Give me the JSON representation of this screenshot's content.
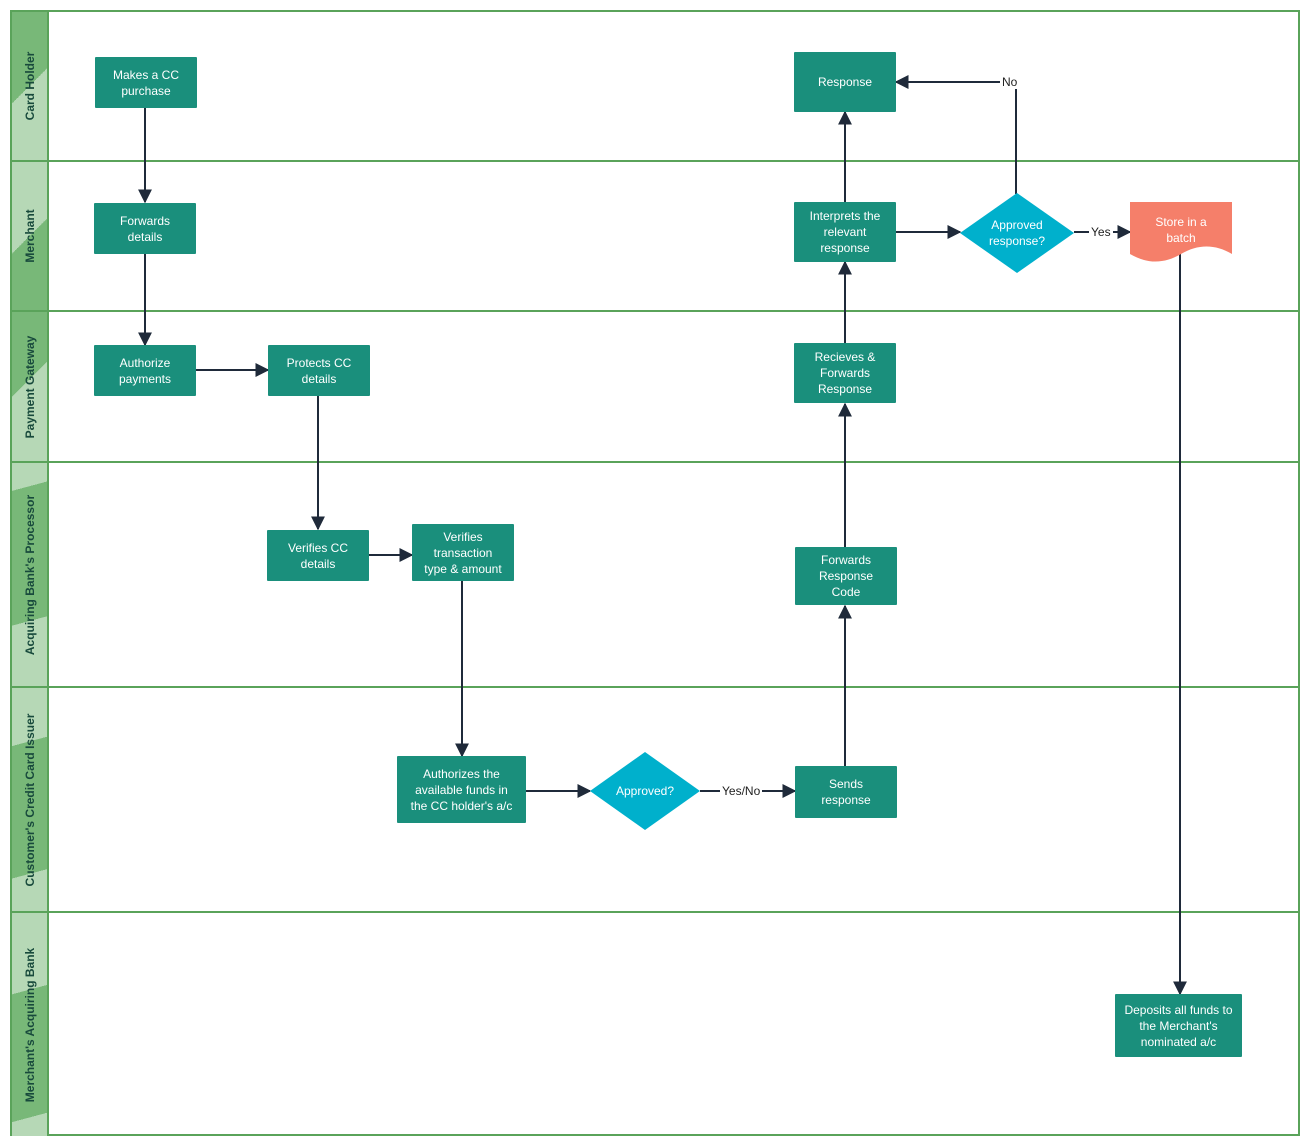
{
  "diagram": {
    "type": "swimlane-flowchart",
    "colors": {
      "lane_border": "#5aa35a",
      "lane_header_dark": "#78b878",
      "lane_header_light": "#b6d8b6",
      "lane_title_text": "#184a3c",
      "process": "#1a8f7c",
      "decision": "#00b0cc",
      "document": "#f57f6a",
      "connector": "#1f2a3a"
    },
    "lanes": [
      {
        "id": "card-holder",
        "label": "Card Holder"
      },
      {
        "id": "merchant",
        "label": "Merchant"
      },
      {
        "id": "payment-gateway",
        "label": "Payment Gateway"
      },
      {
        "id": "acquiring-processor",
        "label": "Acquiring Bank's Processor"
      },
      {
        "id": "credit-card-issuer",
        "label": "Customer's Credit Card Issuer"
      },
      {
        "id": "acquiring-bank",
        "label": "Merchant's Acquiring Bank"
      }
    ],
    "nodes": {
      "makes_purchase": {
        "lane": "card-holder",
        "shape": "process",
        "label": "Makes a CC\npurchase"
      },
      "response": {
        "lane": "card-holder",
        "shape": "process",
        "label": "Response"
      },
      "forwards_details": {
        "lane": "merchant",
        "shape": "process",
        "label": "Forwards\ndetails"
      },
      "interprets": {
        "lane": "merchant",
        "shape": "process",
        "label": "Interprets the\nrelevant\nresponse"
      },
      "approved_response": {
        "lane": "merchant",
        "shape": "decision",
        "label": "Approved\nresponse?"
      },
      "store_batch": {
        "lane": "merchant",
        "shape": "document",
        "label": "Store in a\nbatch"
      },
      "authorize_payments": {
        "lane": "payment-gateway",
        "shape": "process",
        "label": "Authorize\npayments"
      },
      "protects_cc": {
        "lane": "payment-gateway",
        "shape": "process",
        "label": "Protects CC\ndetails"
      },
      "receives_forwards": {
        "lane": "payment-gateway",
        "shape": "process",
        "label": "Recieves &\nForwards\nResponse"
      },
      "verifies_cc": {
        "lane": "acquiring-processor",
        "shape": "process",
        "label": "Verifies CC\ndetails"
      },
      "verifies_txn": {
        "lane": "acquiring-processor",
        "shape": "process",
        "label": "Verifies\ntransaction\ntype & amount"
      },
      "forwards_code": {
        "lane": "acquiring-processor",
        "shape": "process",
        "label": "Forwards\nResponse\nCode"
      },
      "authorizes_funds": {
        "lane": "credit-card-issuer",
        "shape": "process",
        "label": "Authorizes the\navailable funds in\nthe CC holder's a/c"
      },
      "approved": {
        "lane": "credit-card-issuer",
        "shape": "decision",
        "label": "Approved?"
      },
      "sends_response": {
        "lane": "credit-card-issuer",
        "shape": "process",
        "label": "Sends\nresponse"
      },
      "deposits": {
        "lane": "acquiring-bank",
        "shape": "process",
        "label": "Deposits all funds to\nthe Merchant's\nnominated a/c"
      }
    },
    "edges": [
      {
        "from": "makes_purchase",
        "to": "forwards_details",
        "label": ""
      },
      {
        "from": "forwards_details",
        "to": "authorize_payments",
        "label": ""
      },
      {
        "from": "authorize_payments",
        "to": "protects_cc",
        "label": ""
      },
      {
        "from": "protects_cc",
        "to": "verifies_cc",
        "label": ""
      },
      {
        "from": "verifies_cc",
        "to": "verifies_txn",
        "label": ""
      },
      {
        "from": "verifies_txn",
        "to": "authorizes_funds",
        "label": ""
      },
      {
        "from": "authorizes_funds",
        "to": "approved",
        "label": ""
      },
      {
        "from": "approved",
        "to": "sends_response",
        "label": "Yes/No"
      },
      {
        "from": "sends_response",
        "to": "forwards_code",
        "label": ""
      },
      {
        "from": "forwards_code",
        "to": "receives_forwards",
        "label": ""
      },
      {
        "from": "receives_forwards",
        "to": "interprets",
        "label": ""
      },
      {
        "from": "interprets",
        "to": "response",
        "label": ""
      },
      {
        "from": "interprets",
        "to": "approved_response",
        "label": ""
      },
      {
        "from": "approved_response",
        "to": "response",
        "label": "No"
      },
      {
        "from": "approved_response",
        "to": "store_batch",
        "label": "Yes"
      },
      {
        "from": "store_batch",
        "to": "deposits",
        "label": ""
      }
    ],
    "edge_labels": {
      "no": "No",
      "yes": "Yes",
      "yes_no": "Yes/No"
    }
  }
}
